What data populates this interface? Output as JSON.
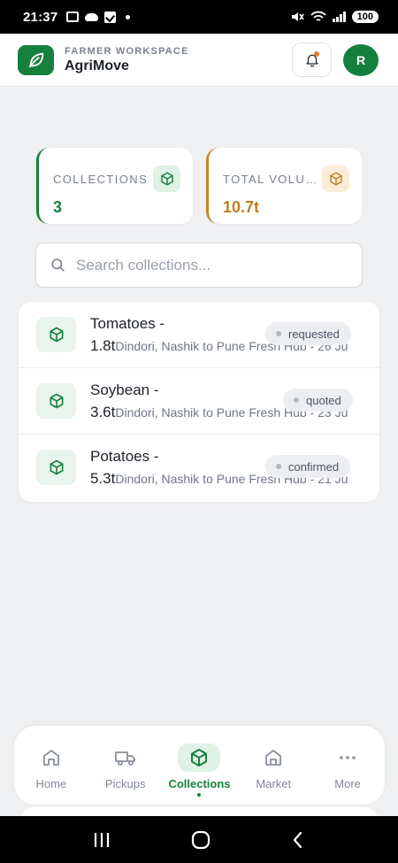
{
  "status_bar": {
    "time": "21:37",
    "battery": "100"
  },
  "header": {
    "subtitle": "FARMER WORKSPACE",
    "title": "AgriMove",
    "avatar_initial": "R"
  },
  "stats": [
    {
      "label": "COLLECTIONS",
      "value": "3",
      "icon": "package-icon",
      "accent": "#15803d"
    },
    {
      "label": "TOTAL VOLUME",
      "value": "10.7t",
      "icon": "package-icon",
      "accent": "#c07f22"
    }
  ],
  "search": {
    "placeholder": "Search collections...",
    "value": ""
  },
  "collections": [
    {
      "title": "Tomatoes -",
      "qty": "1.8t",
      "route": "Dindori, Nashik to Pune Fresh Hub - 26 Ju",
      "status": "requested"
    },
    {
      "title": "Soybean -",
      "qty": "3.6t",
      "route": "Dindori, Nashik to Pune Fresh Hub - 23 Ju",
      "status": "quoted"
    },
    {
      "title": "Potatoes -",
      "qty": "5.3t",
      "route": "Dindori, Nashik to Pune Fresh Hub - 21 Ju",
      "status": "confirmed"
    }
  ],
  "nav": [
    {
      "label": "Home",
      "icon": "home-icon",
      "active": false
    },
    {
      "label": "Pickups",
      "icon": "truck-icon",
      "active": false
    },
    {
      "label": "Collections",
      "icon": "package-icon",
      "active": true
    },
    {
      "label": "Market",
      "icon": "store-icon",
      "active": false
    },
    {
      "label": "More",
      "icon": "more-icon",
      "active": false
    }
  ],
  "colors": {
    "brand": "#15803d",
    "amber": "#c07f22",
    "background": "#eff0f2"
  }
}
